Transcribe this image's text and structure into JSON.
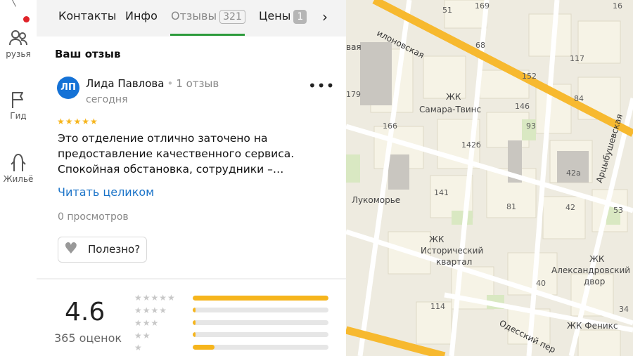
{
  "rail": {
    "items": [
      {
        "label": "рузья",
        "icon": "friends-icon"
      },
      {
        "label": "Гид",
        "icon": "flag-icon"
      },
      {
        "label": "Жильё",
        "icon": "housing-icon"
      }
    ],
    "top_glyph": "╲"
  },
  "tabs": {
    "items": [
      {
        "label": "Контакты"
      },
      {
        "label": "Инфо"
      },
      {
        "label": "Отзывы",
        "badge": "321"
      },
      {
        "label": "Цены",
        "badge": "1"
      }
    ],
    "active": "Отзывы",
    "next_glyph": "›"
  },
  "review": {
    "section_title": "Ваш отзыв",
    "avatar_initials": "ЛП",
    "author": "Лида Павлова",
    "separator": "•",
    "author_reviews": "1 отзыв",
    "date": "сегодня",
    "more_glyph": "⋮",
    "stars": "★★★★★",
    "rating": 5,
    "text": "Это отделение отлично заточено на предоставление качественного сервиса. Спокойная обстановка, сотрудники –…",
    "read_more": "Читать целиком",
    "views": "0 просмотров",
    "helpful_label": "Полезно?"
  },
  "summary": {
    "rating": "4.6",
    "count": "365 оценок",
    "distribution": [
      {
        "stars": "★★★★★",
        "fraction": 1.0
      },
      {
        "stars": "★★★★",
        "fraction": 0.02
      },
      {
        "stars": "★★★",
        "fraction": 0.02
      },
      {
        "stars": "★★",
        "fraction": 0.02
      },
      {
        "stars": "★",
        "fraction": 0.16
      }
    ]
  },
  "colors": {
    "accent_green": "#2c9b3c",
    "star_yellow": "#f6b51c",
    "link_blue": "#1a73c8",
    "avatar_blue": "#1572d6",
    "notification_red": "#e0242a"
  },
  "map": {
    "labels": {
      "street_top": "илоновская",
      "street_right": "Арцыбушевская",
      "street_bottom": "Одесский пер",
      "zhk1_a": "ЖК",
      "zhk1_b": "Самара-Твинс",
      "lukomorye": "Лукоморье",
      "zhk2_a": "ЖК",
      "zhk2_b": "Исторический",
      "zhk2_c": "квартал",
      "zhk3_a": "ЖК",
      "zhk3_b": "Александровский",
      "zhk3_c": "двор",
      "zhk4": "ЖК Феникс",
      "vaya": "вая"
    },
    "numbers": [
      "169",
      "51",
      "16",
      "68",
      "117",
      "152",
      "179",
      "146",
      "84",
      "166",
      "93",
      "142б",
      "42а",
      "141",
      "81",
      "42",
      "53",
      "114",
      "40",
      "34"
    ]
  }
}
